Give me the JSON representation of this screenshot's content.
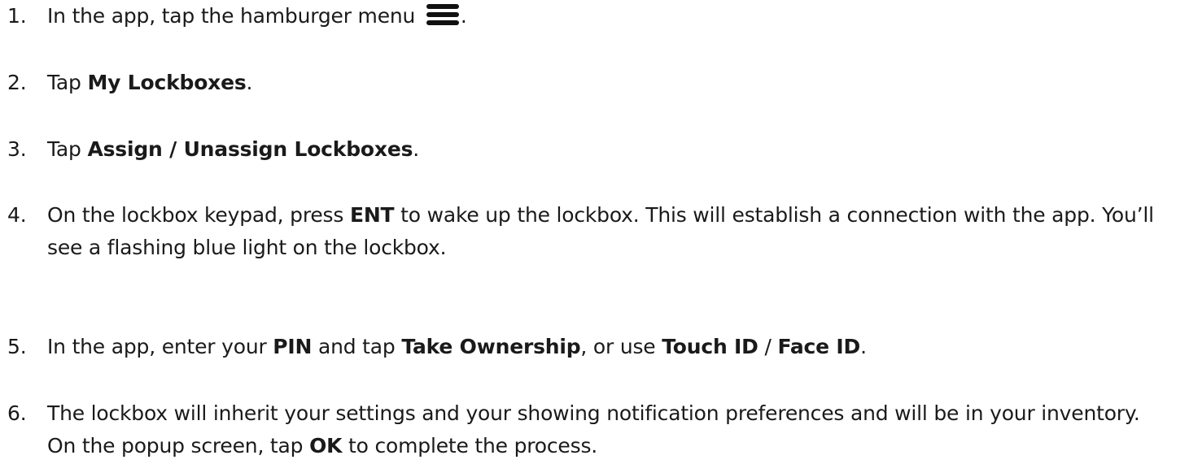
{
  "steps": [
    {
      "number": "1.",
      "parts": [
        "In the app, tap the hamburger menu ",
        "."
      ],
      "icon": "hamburger-menu-icon"
    },
    {
      "number": "2.",
      "parts": [
        "Tap ",
        "My Lockboxes",
        "."
      ]
    },
    {
      "number": "3.",
      "parts": [
        "Tap ",
        "Assign / Unassign Lockboxes",
        "."
      ]
    },
    {
      "number": "4.",
      "parts": [
        "On the lockbox keypad, press ",
        "ENT",
        " to wake up the lockbox. This will establish a connection with the app. You’ll see a flashing blue light on the lockbox."
      ]
    },
    {
      "number": "5.",
      "parts": [
        "In the app, enter your ",
        "PIN",
        " and tap ",
        "Take Ownership",
        ", or use ",
        "Touch ID",
        " / ",
        "Face ID",
        "."
      ]
    },
    {
      "number": "6.",
      "parts": [
        "The lockbox will inherit your settings and your showing notification preferences and will be in your inventory. On the popup screen, tap ",
        "OK",
        " to complete the process."
      ]
    }
  ]
}
